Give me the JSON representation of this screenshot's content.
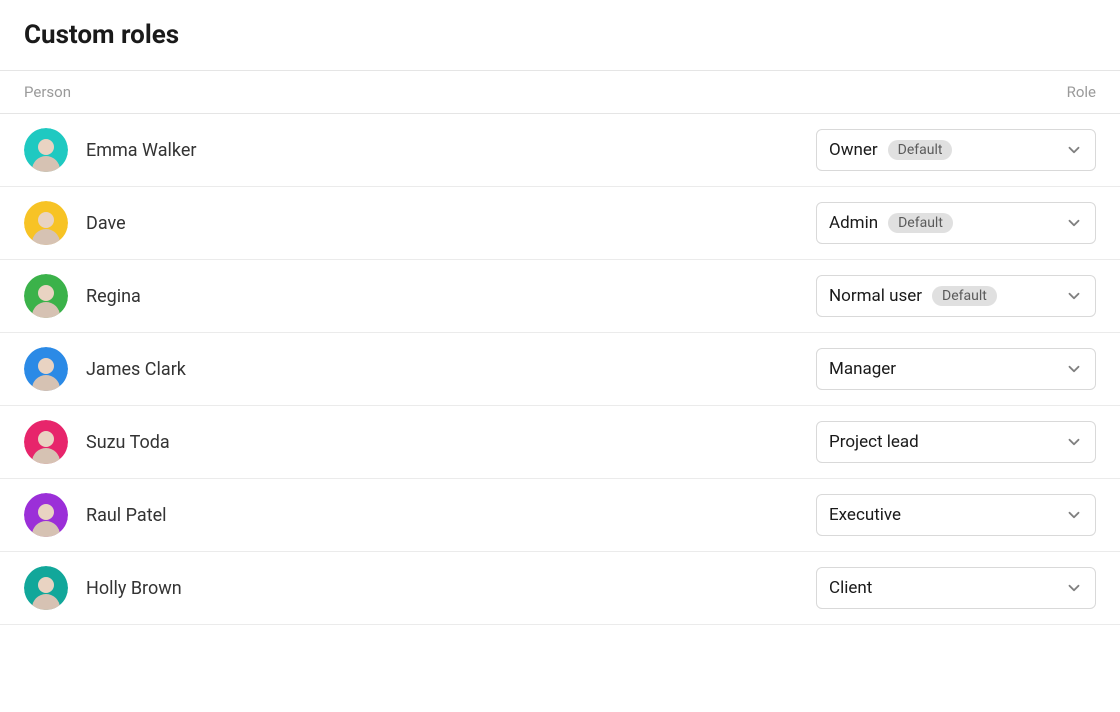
{
  "title": "Custom roles",
  "columns": {
    "person": "Person",
    "role": "Role"
  },
  "default_badge": "Default",
  "people": [
    {
      "name": "Emma Walker",
      "role": "Owner",
      "is_default": true,
      "avatar_color": "#1fc9c1"
    },
    {
      "name": "Dave",
      "role": "Admin",
      "is_default": true,
      "avatar_color": "#f7c325"
    },
    {
      "name": "Regina",
      "role": "Normal user",
      "is_default": true,
      "avatar_color": "#3bb24a"
    },
    {
      "name": "James Clark",
      "role": "Manager",
      "is_default": false,
      "avatar_color": "#2b8ae6"
    },
    {
      "name": "Suzu Toda",
      "role": "Project lead",
      "is_default": false,
      "avatar_color": "#e7256b"
    },
    {
      "name": "Raul Patel",
      "role": "Executive",
      "is_default": false,
      "avatar_color": "#9b2fd8"
    },
    {
      "name": "Holly Brown",
      "role": "Client",
      "is_default": false,
      "avatar_color": "#12a79a"
    }
  ]
}
